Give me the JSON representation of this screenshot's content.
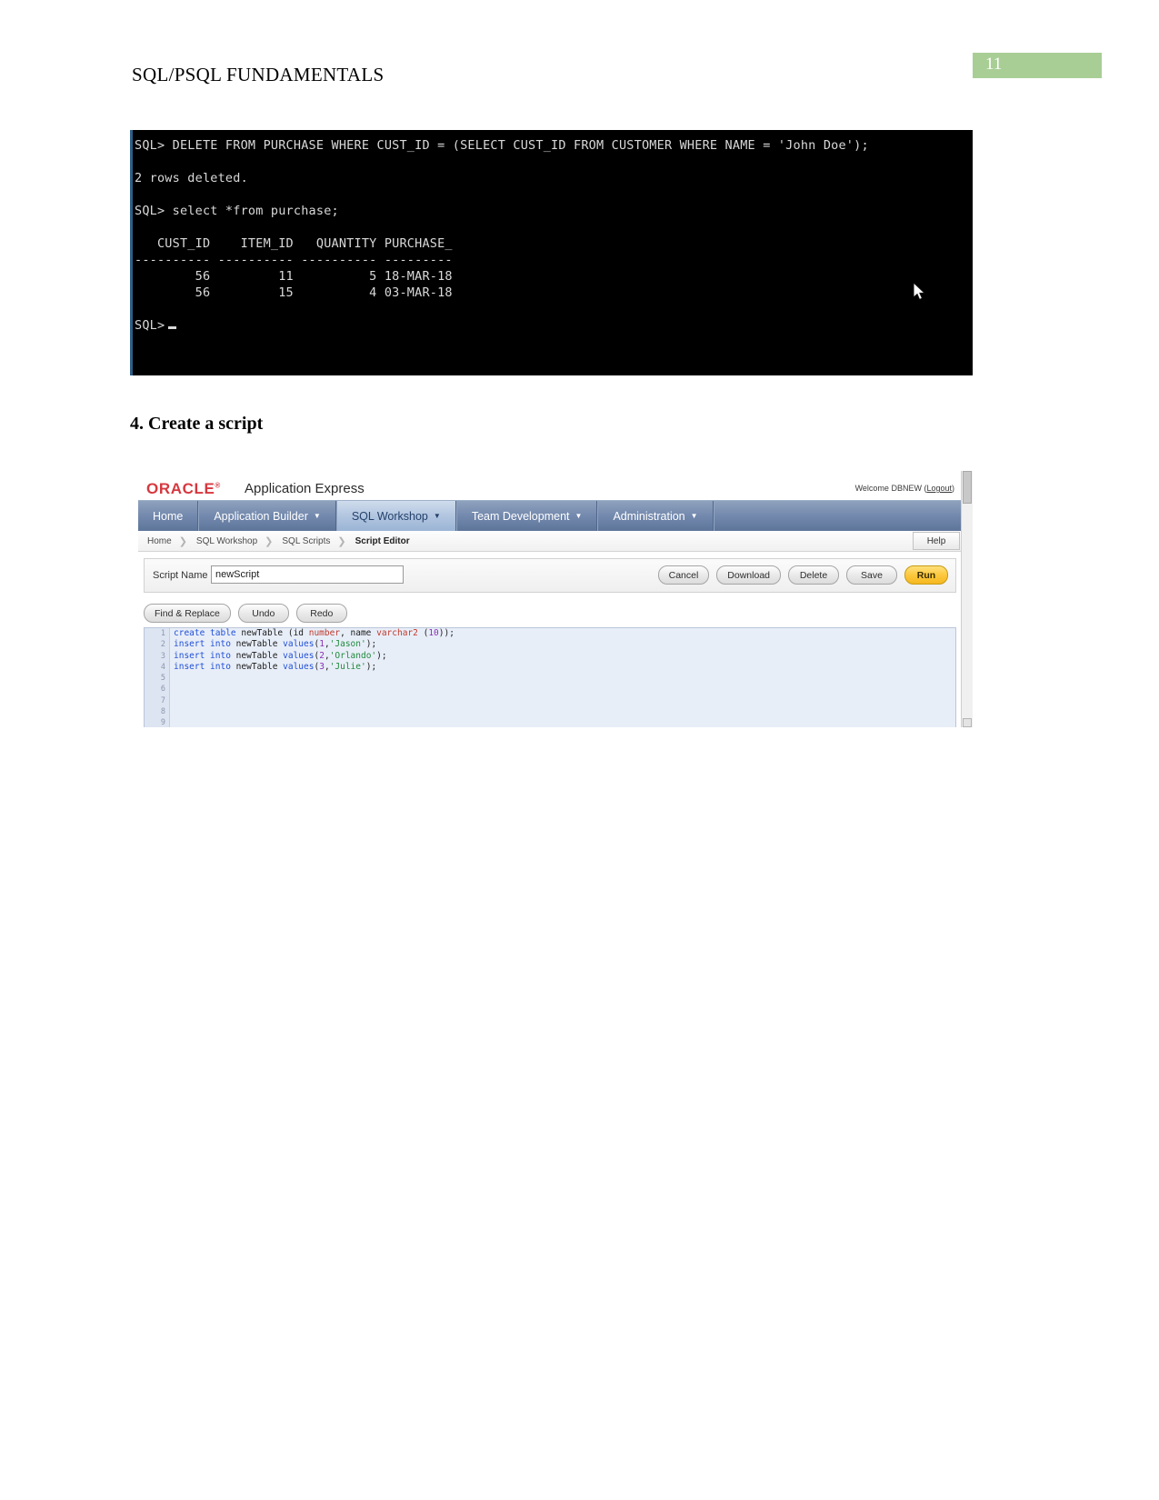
{
  "document": {
    "header_title": "SQL/PSQL FUNDAMENTALS",
    "page_number": "11",
    "page_number_color": "#a8ce95"
  },
  "terminal": {
    "lines": [
      "SQL> DELETE FROM PURCHASE WHERE CUST_ID = (SELECT CUST_ID FROM CUSTOMER WHERE NAME = 'John Doe');",
      "",
      "2 rows deleted.",
      "",
      "SQL> select *from purchase;",
      "",
      "   CUST_ID    ITEM_ID   QUANTITY PURCHASE_",
      "---------- ---------- ---------- ---------",
      "        56         11          5 18-MAR-18",
      "        56         15          4 03-MAR-18",
      "",
      "SQL>"
    ]
  },
  "section": {
    "heading": "4. Create a script"
  },
  "apex": {
    "brand": {
      "oracle": "ORACLE",
      "product": "Application Express",
      "welcome_text": "Welcome DBNEW",
      "logout_open": "(",
      "logout": "Logout",
      "logout_close": ")"
    },
    "nav": [
      {
        "label": "Home",
        "has_caret": false,
        "active": false
      },
      {
        "label": "Application Builder",
        "has_caret": true,
        "active": false
      },
      {
        "label": "SQL Workshop",
        "has_caret": true,
        "active": true
      },
      {
        "label": "Team Development",
        "has_caret": true,
        "active": false
      },
      {
        "label": "Administration",
        "has_caret": true,
        "active": false
      }
    ],
    "breadcrumbs": [
      {
        "label": "Home",
        "current": false
      },
      {
        "label": "SQL Workshop",
        "current": false
      },
      {
        "label": "SQL Scripts",
        "current": false
      },
      {
        "label": "Script Editor",
        "current": true
      }
    ],
    "help_label": "Help",
    "toolbar": {
      "script_name_label": "Script Name",
      "script_name_value": "newScript",
      "buttons": [
        {
          "label": "Cancel",
          "primary": false
        },
        {
          "label": "Download",
          "primary": false
        },
        {
          "label": "Delete",
          "primary": false
        },
        {
          "label": "Save",
          "primary": false
        },
        {
          "label": "Run",
          "primary": true
        }
      ]
    },
    "editor_tools": [
      {
        "label": "Find & Replace"
      },
      {
        "label": "Undo"
      },
      {
        "label": "Redo"
      }
    ],
    "editor": {
      "line_numbers": [
        "1",
        "2",
        "3",
        "4",
        "5",
        "6",
        "7",
        "8",
        "9"
      ],
      "code_lines": [
        [
          {
            "t": "create ",
            "c": "tok-kw"
          },
          {
            "t": "table ",
            "c": "tok-kw"
          },
          {
            "t": "newTable (id ",
            "c": "tok-plain"
          },
          {
            "t": "number",
            "c": "tok-type"
          },
          {
            "t": ", name ",
            "c": "tok-plain"
          },
          {
            "t": "varchar2 ",
            "c": "tok-type"
          },
          {
            "t": "(",
            "c": "tok-plain"
          },
          {
            "t": "10",
            "c": "tok-num"
          },
          {
            "t": "));",
            "c": "tok-plain"
          }
        ],
        [
          {
            "t": "insert ",
            "c": "tok-kw"
          },
          {
            "t": "into ",
            "c": "tok-kw"
          },
          {
            "t": "newTable ",
            "c": "tok-plain"
          },
          {
            "t": "values",
            "c": "tok-kw"
          },
          {
            "t": "(",
            "c": "tok-plain"
          },
          {
            "t": "1",
            "c": "tok-num"
          },
          {
            "t": ",",
            "c": "tok-plain"
          },
          {
            "t": "'Jason'",
            "c": "tok-str"
          },
          {
            "t": ");",
            "c": "tok-plain"
          }
        ],
        [
          {
            "t": "insert ",
            "c": "tok-kw"
          },
          {
            "t": "into ",
            "c": "tok-kw"
          },
          {
            "t": "newTable ",
            "c": "tok-plain"
          },
          {
            "t": "values",
            "c": "tok-kw"
          },
          {
            "t": "(",
            "c": "tok-plain"
          },
          {
            "t": "2",
            "c": "tok-num"
          },
          {
            "t": ",",
            "c": "tok-plain"
          },
          {
            "t": "'Orlando'",
            "c": "tok-str"
          },
          {
            "t": ");",
            "c": "tok-plain"
          }
        ],
        [
          {
            "t": "insert ",
            "c": "tok-kw"
          },
          {
            "t": "into ",
            "c": "tok-kw"
          },
          {
            "t": "newTable ",
            "c": "tok-plain"
          },
          {
            "t": "values",
            "c": "tok-kw"
          },
          {
            "t": "(",
            "c": "tok-plain"
          },
          {
            "t": "3",
            "c": "tok-num"
          },
          {
            "t": ",",
            "c": "tok-plain"
          },
          {
            "t": "'Julie'",
            "c": "tok-str"
          },
          {
            "t": ");",
            "c": "tok-plain"
          }
        ],
        [],
        [],
        [],
        [],
        []
      ]
    }
  }
}
